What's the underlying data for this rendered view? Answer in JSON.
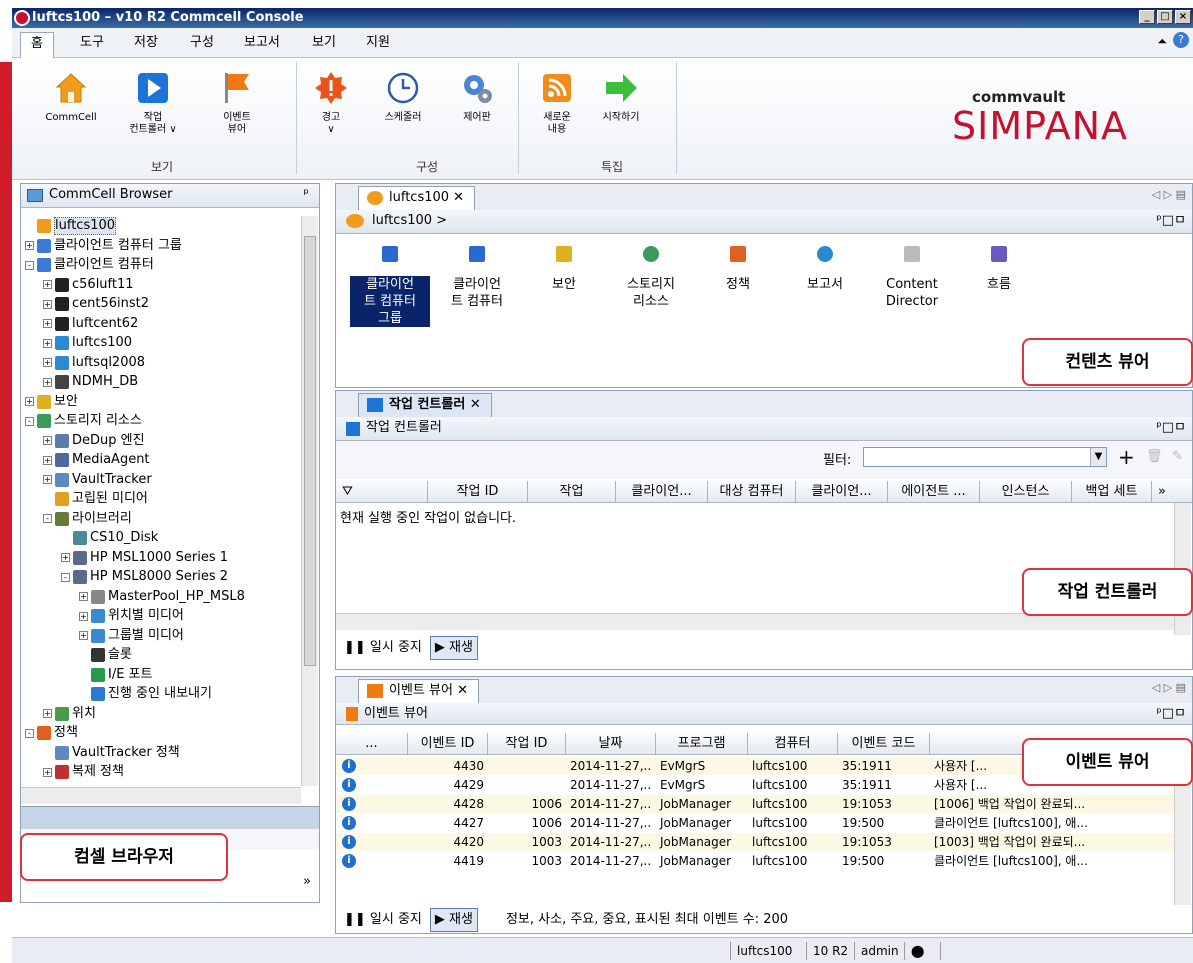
{
  "window": {
    "title": "luftcs100 – v10 R2 Commcell Console",
    "controls": [
      "_",
      "□",
      "×"
    ]
  },
  "menu": {
    "tabs": [
      "홈",
      "도구",
      "저장",
      "구성",
      "보고서",
      "보기",
      "지원"
    ],
    "active": "홈"
  },
  "ribbon": {
    "groups": [
      {
        "label": "보기",
        "buttons": [
          "CommCell",
          "작업\n컨트롤러 ∨",
          "이벤트\n뷰어"
        ]
      },
      {
        "label": "구성",
        "buttons": [
          "경고\n∨",
          "스케줄러",
          "제어판"
        ]
      },
      {
        "label": "특집",
        "buttons": [
          "새로운\n내용",
          "시작하기"
        ]
      }
    ],
    "brand_top": "commvault",
    "brand_main": "SIMPANA",
    "colors": {
      "orange": "#f29b1d",
      "blue": "#1e73d8",
      "red": "#d11a2a",
      "green": "#3cbf3c"
    }
  },
  "left_panel": {
    "header": "CommCell Browser",
    "pin": "ᵖ",
    "tree": [
      {
        "label": "luftcs100",
        "depth": 0,
        "expander": "",
        "icon": "commcell-icon",
        "selected": true
      },
      {
        "label": "클라이언트 컴퓨터 그룹",
        "depth": 0,
        "expander": "+",
        "icon": "client-group-icon"
      },
      {
        "label": "클라이언트 컴퓨터",
        "depth": 0,
        "expander": "-",
        "icon": "client-group-icon"
      },
      {
        "label": "c56luft11",
        "depth": 1,
        "expander": "+",
        "icon": "linux-icon"
      },
      {
        "label": "cent56inst2",
        "depth": 1,
        "expander": "+",
        "icon": "linux-icon"
      },
      {
        "label": "luftcent62",
        "depth": 1,
        "expander": "+",
        "icon": "linux-icon"
      },
      {
        "label": "luftcs100",
        "depth": 1,
        "expander": "+",
        "icon": "windows-icon"
      },
      {
        "label": "luftsql2008",
        "depth": 1,
        "expander": "+",
        "icon": "windows-icon"
      },
      {
        "label": "NDMH_DB",
        "depth": 1,
        "expander": "+",
        "icon": "ndmp-icon"
      },
      {
        "label": "보안",
        "depth": 0,
        "expander": "+",
        "icon": "lock-icon"
      },
      {
        "label": "스토리지 리소스",
        "depth": 0,
        "expander": "-",
        "icon": "storage-icon"
      },
      {
        "label": "DeDup 엔진",
        "depth": 1,
        "expander": "+",
        "icon": "dedup-icon"
      },
      {
        "label": "MediaAgent",
        "depth": 1,
        "expander": "+",
        "icon": "mediaagent-icon"
      },
      {
        "label": "VaultTracker",
        "depth": 1,
        "expander": "+",
        "icon": "vaulttracker-icon"
      },
      {
        "label": "고립된 미디어",
        "depth": 1,
        "expander": "",
        "icon": "media-icon"
      },
      {
        "label": "라이브러리",
        "depth": 1,
        "expander": "-",
        "icon": "library-icon"
      },
      {
        "label": "CS10_Disk",
        "depth": 2,
        "expander": "",
        "icon": "disk-library-icon"
      },
      {
        "label": "HP MSL1000 Series 1",
        "depth": 2,
        "expander": "+",
        "icon": "tape-library-icon"
      },
      {
        "label": "HP MSL8000 Series 2",
        "depth": 2,
        "expander": "-",
        "icon": "tape-library-icon"
      },
      {
        "label": "MasterPool_HP_MSL8",
        "depth": 3,
        "expander": "+",
        "icon": "pool-icon"
      },
      {
        "label": "위치별 미디어",
        "depth": 3,
        "expander": "+",
        "icon": "media-location-icon"
      },
      {
        "label": "그룹별 미디어",
        "depth": 3,
        "expander": "+",
        "icon": "media-group-icon"
      },
      {
        "label": "슬롯",
        "depth": 3,
        "expander": "",
        "icon": "slot-icon"
      },
      {
        "label": "I/E 포트",
        "depth": 3,
        "expander": "",
        "icon": "ie-port-icon"
      },
      {
        "label": "진행 중인 내보내기",
        "depth": 3,
        "expander": "",
        "icon": "export-icon"
      },
      {
        "label": "위치",
        "depth": 1,
        "expander": "+",
        "icon": "location-icon"
      },
      {
        "label": "정책",
        "depth": 0,
        "expander": "-",
        "icon": "policy-icon"
      },
      {
        "label": "VaultTracker 정책",
        "depth": 1,
        "expander": "",
        "icon": "vaulttracker-icon"
      },
      {
        "label": "복제 정책",
        "depth": 1,
        "expander": "+",
        "icon": "replication-icon"
      }
    ],
    "callout": "컴셀 브라우저",
    "more": "»"
  },
  "content_viewer": {
    "tab": "luftcs100",
    "breadcrumb": "luftcs100 >",
    "items": [
      {
        "label": "클라이언\n트 컴퓨터\n그룹",
        "selected": true
      },
      {
        "label": "클라이언\n트 컴퓨터",
        "selected": false
      },
      {
        "label": "보안",
        "selected": false
      },
      {
        "label": "스토리지\n리소스",
        "selected": false
      },
      {
        "label": "정책",
        "selected": false
      },
      {
        "label": "보고서",
        "selected": false
      },
      {
        "label": "Content\nDirector",
        "selected": false
      },
      {
        "label": "흐름",
        "selected": false
      }
    ],
    "callout": "컨텐츠 뷰어",
    "window_icons": "ᵖ□ㅁ"
  },
  "job_controller": {
    "tab": "작업 컨트롤러",
    "title": "작업 컨트롤러",
    "filter_label": "필터:",
    "filter_value": "",
    "columns": [
      "작업 ID",
      "작업",
      "클라이언...",
      "대상 컴퓨터",
      "클라이언...",
      "에이전트 ...",
      "인스턴스",
      "백업 세트"
    ],
    "empty_message": "현재 실행 중인 작업이 없습니다.",
    "pause_label": "일시 중지",
    "play_label": "재생",
    "callout": "작업 컨트롤러"
  },
  "event_viewer": {
    "tab": "이벤트 뷰어",
    "title": "이벤트 뷰어",
    "columns": [
      "...",
      "이벤트 ID",
      "작업 ID",
      "날짜",
      "프로그램",
      "컴퓨터",
      "이벤트 코드",
      ""
    ],
    "rows": [
      {
        "event_id": "4430",
        "job_id": "",
        "date": "2014-11-27,..",
        "program": "EvMgrS",
        "computer": "luftcs100",
        "code": "35:1911",
        "desc": "사용자 [..."
      },
      {
        "event_id": "4429",
        "job_id": "",
        "date": "2014-11-27,..",
        "program": "EvMgrS",
        "computer": "luftcs100",
        "code": "35:1911",
        "desc": "사용자 [..."
      },
      {
        "event_id": "4428",
        "job_id": "1006",
        "date": "2014-11-27,..",
        "program": "JobManager",
        "computer": "luftcs100",
        "code": "19:1053",
        "desc": "[1006] 백업 작업이 완료되..."
      },
      {
        "event_id": "4427",
        "job_id": "1006",
        "date": "2014-11-27,..",
        "program": "JobManager",
        "computer": "luftcs100",
        "code": "19:500",
        "desc": "클라이언트 [luftcs100], 애..."
      },
      {
        "event_id": "4420",
        "job_id": "1003",
        "date": "2014-11-27,..",
        "program": "JobManager",
        "computer": "luftcs100",
        "code": "19:1053",
        "desc": "[1003] 백업 작업이 완료되..."
      },
      {
        "event_id": "4419",
        "job_id": "1003",
        "date": "2014-11-27,..",
        "program": "JobManager",
        "computer": "luftcs100",
        "code": "19:500",
        "desc": "클라이언트 [luftcs100], 애..."
      }
    ],
    "pause_label": "일시 중지",
    "play_label": "재생",
    "footer_text": "정보, 사소, 주요, 중요, 표시된 최대 이벤트 수: 200",
    "callout": "이벤트 뷰어"
  },
  "statusbar": {
    "host": "luftcs100",
    "version": "10 R2",
    "user": "admin"
  }
}
